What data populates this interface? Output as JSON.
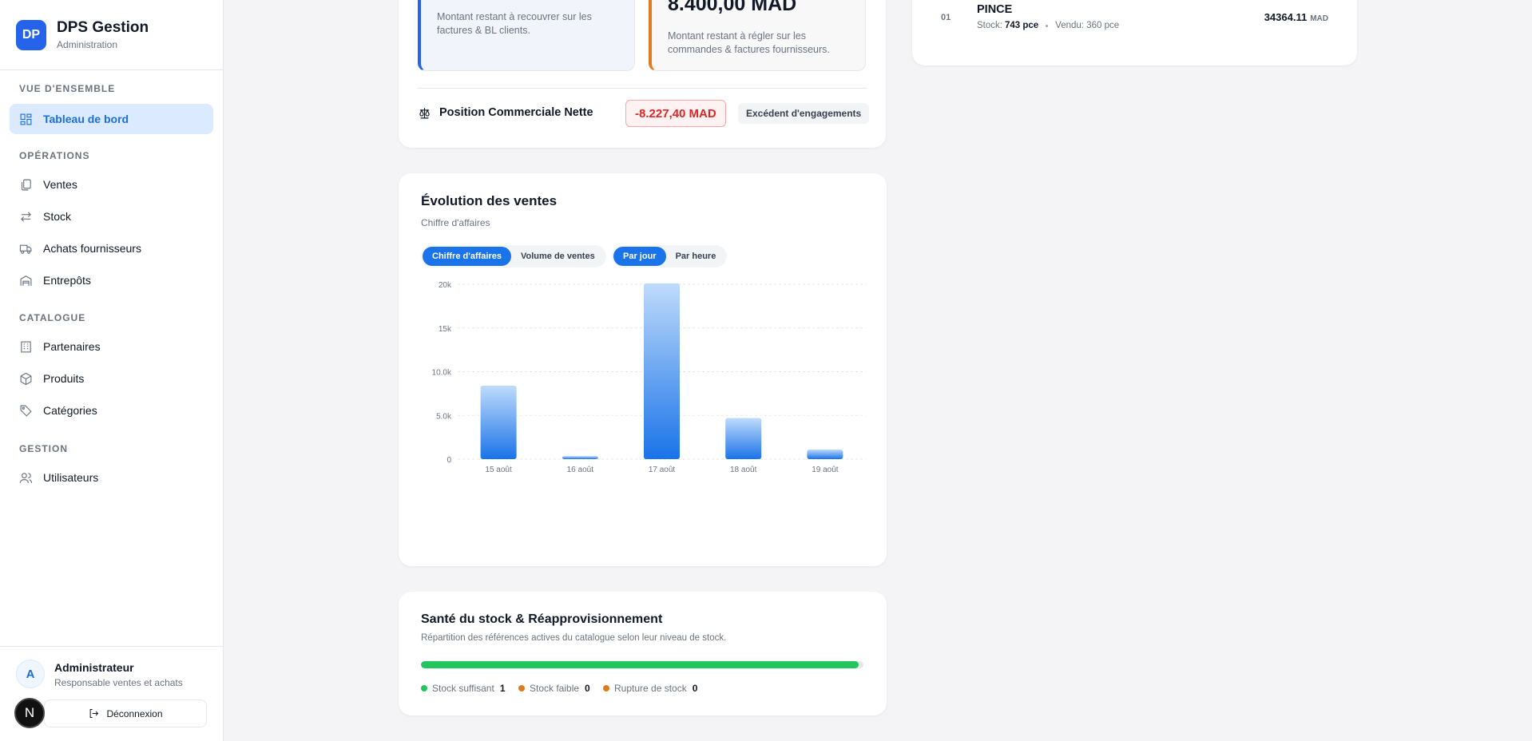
{
  "brand": {
    "logo": "DP",
    "title": "DPS Gestion",
    "subtitle": "Administration"
  },
  "sidebar": {
    "sections": [
      {
        "title": "VUE D'ENSEMBLE"
      },
      {
        "title": "OPÉRATIONS"
      },
      {
        "title": "CATALOGUE"
      },
      {
        "title": "GESTION"
      }
    ],
    "items": [
      {
        "label": "Tableau de bord",
        "icon": "dashboard-icon",
        "active": true
      },
      {
        "label": "Ventes",
        "icon": "sales-icon"
      },
      {
        "label": "Stock",
        "icon": "transfer-icon"
      },
      {
        "label": "Achats fournisseurs",
        "icon": "truck-icon"
      },
      {
        "label": "Entrepôts",
        "icon": "warehouse-icon"
      },
      {
        "label": "Partenaires",
        "icon": "building-icon"
      },
      {
        "label": "Produits",
        "icon": "box-icon"
      },
      {
        "label": "Catégories",
        "icon": "tag-icon"
      },
      {
        "label": "Utilisateurs",
        "icon": "users-icon"
      }
    ]
  },
  "user": {
    "initial": "A",
    "name": "Administrateur",
    "role": "Responsable ventes et achats",
    "logout_label": "Déconnexion"
  },
  "next_badge": "N",
  "balances": {
    "clients_desc": "Montant restant à recouvrer sur les factures & BL clients.",
    "suppliers_amount": "8.400,00 MAD",
    "suppliers_desc": "Montant restant à régler sur les commandes & factures fournisseurs.",
    "net_label": "Position Commerciale Nette",
    "net_value": "-8.227,40 MAD",
    "net_status": "Excédent d'engagements"
  },
  "sales_chart": {
    "title": "Évolution des ventes",
    "subtitle": "Chiffre d'affaires",
    "metric_toggles": [
      {
        "label": "Chiffre d'affaires",
        "active": true
      },
      {
        "label": "Volume de ventes",
        "active": false
      }
    ],
    "period_toggles": [
      {
        "label": "Par jour",
        "active": true
      },
      {
        "label": "Par heure",
        "active": false
      }
    ]
  },
  "chart_data": {
    "type": "bar",
    "categories": [
      "15 août",
      "16 août",
      "17 août",
      "18 août",
      "19 août"
    ],
    "values": [
      8400,
      350,
      20100,
      4700,
      1100
    ],
    "yticks": [
      {
        "value": 0,
        "label": "0"
      },
      {
        "value": 5000,
        "label": "5.0k"
      },
      {
        "value": 10000,
        "label": "10.0k"
      },
      {
        "value": 15000,
        "label": "15k"
      },
      {
        "value": 20000,
        "label": "20k"
      }
    ],
    "ylim": [
      0,
      20000
    ],
    "grid": true,
    "color_top": "#bfdbfb",
    "color_bottom": "#1a73e8"
  },
  "stock_health": {
    "title": "Santé du stock & Réapprovisionnement",
    "subtitle": "Répartition des références actives du catalogue selon leur niveau de stock.",
    "fill_percent": 99,
    "legend": [
      {
        "label": "Stock suffisant",
        "count": "1",
        "color": "#22c55e"
      },
      {
        "label": "Stock faible",
        "count": "0",
        "color": "#e07a1f"
      },
      {
        "label": "Rupture de stock",
        "count": "0",
        "color": "#e07a1f"
      }
    ]
  },
  "top_products": [
    {
      "rank": "01",
      "name": "PINCE",
      "stock_label": "Stock:",
      "stock": "743 pce",
      "sold": "Vendu: 360 pce",
      "value": "34364.11",
      "currency": "MAD"
    }
  ]
}
